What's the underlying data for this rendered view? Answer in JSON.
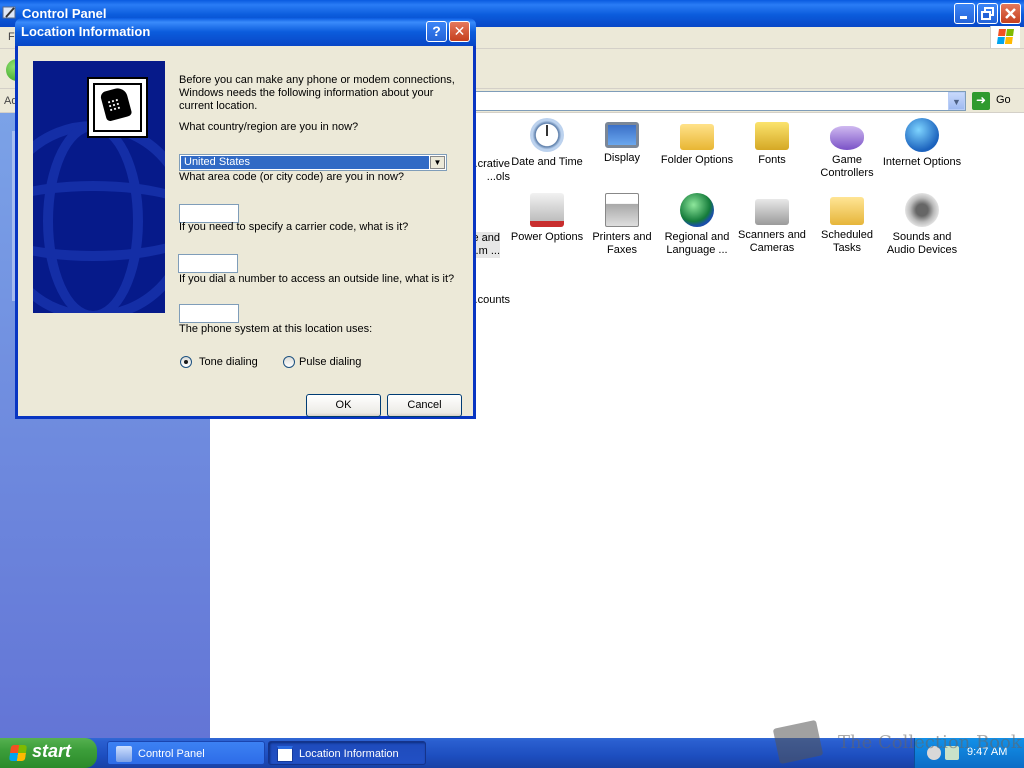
{
  "control_panel": {
    "title": "Control Panel",
    "menu_partial": "F",
    "address_label": "Ad",
    "go_label": "Go",
    "items": [
      {
        "label": "...crative ...ols",
        "icon": "admin-tools-icon"
      },
      {
        "label": "Date and Time",
        "icon": "clock-icon"
      },
      {
        "label": "Display",
        "icon": "display-icon"
      },
      {
        "label": "Folder Options",
        "icon": "folder-options-icon"
      },
      {
        "label": "Fonts",
        "icon": "fonts-icon"
      },
      {
        "label": "Game Controllers",
        "icon": "game-controller-icon"
      },
      {
        "label": "Internet Options",
        "icon": "internet-options-icon"
      },
      {
        "label": "...e and ...m ...",
        "icon": "phone-modem-icon"
      },
      {
        "label": "Power Options",
        "icon": "power-options-icon"
      },
      {
        "label": "Printers and Faxes",
        "icon": "printer-icon"
      },
      {
        "label": "Regional and Language ...",
        "icon": "regional-icon"
      },
      {
        "label": "Scanners and Cameras",
        "icon": "scanner-icon"
      },
      {
        "label": "Scheduled Tasks",
        "icon": "scheduled-tasks-icon"
      },
      {
        "label": "Sounds and Audio Devices",
        "icon": "speaker-icon"
      },
      {
        "label": "...counts",
        "icon": "user-accounts-icon"
      }
    ]
  },
  "dialog": {
    "title": "Location Information",
    "help_glyph": "?",
    "close_glyph": "✕",
    "intro": "Before you can make any phone or modem connections, Windows needs the following information about your current location.",
    "country_question": "What country/region are you in now?",
    "country_value": "United States",
    "area_question": "What area code (or city code) are you in now?",
    "area_value": "",
    "carrier_question": "If you need to specify a carrier code, what is it?",
    "carrier_value": "",
    "outside_question": "If you dial a number to access an outside line, what is it?",
    "outside_value": "",
    "phone_system_label": "The phone system at this location uses:",
    "tone_label": "Tone dialing",
    "pulse_label": "Pulse dialing",
    "selected_dialing": "tone",
    "ok_label": "OK",
    "cancel_label": "Cancel"
  },
  "taskbar": {
    "start_label": "start",
    "tasks": [
      {
        "label": "Control Panel",
        "active": false
      },
      {
        "label": "Location Information",
        "active": true
      }
    ],
    "clock": "9:47 AM"
  },
  "watermark": {
    "text": "The Collection Book"
  }
}
